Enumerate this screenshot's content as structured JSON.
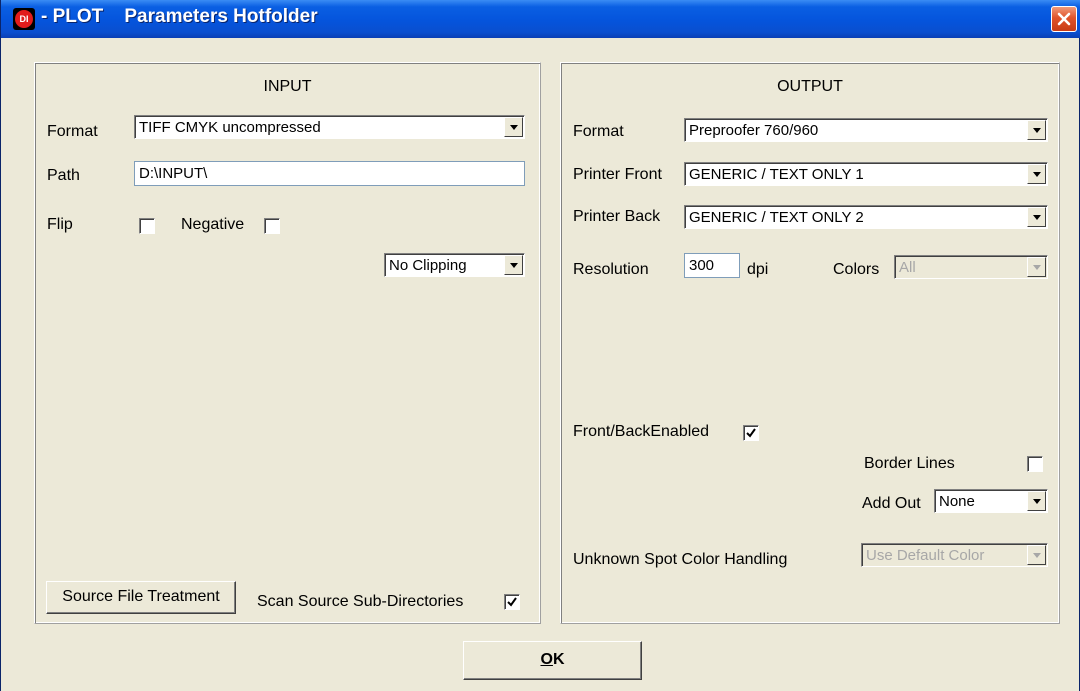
{
  "window": {
    "title": "- PLOT    Parameters Hotfolder",
    "icon_text": "DI"
  },
  "input": {
    "section_title": "INPUT",
    "format_label": "Format",
    "format_value": "TIFF CMYK uncompressed",
    "path_label": "Path",
    "path_value": "D:\\INPUT\\",
    "flip_label": "Flip",
    "flip_checked": false,
    "negative_label": "Negative",
    "negative_checked": false,
    "clipping_value": "No Clipping",
    "source_button_label": "Source File Treatment",
    "scan_subdirs_label": "Scan Source Sub-Directories",
    "scan_subdirs_checked": true
  },
  "output": {
    "section_title": "OUTPUT",
    "format_label": "Format",
    "format_value": "Preproofer 760/960",
    "printer_front_label": "Printer Front",
    "printer_front_value": "GENERIC / TEXT ONLY 1",
    "printer_back_label": "Printer Back",
    "printer_back_value": "GENERIC / TEXT ONLY 2",
    "resolution_label": "Resolution",
    "resolution_value": "300",
    "resolution_unit": "dpi",
    "colors_label": "Colors",
    "colors_value": "All",
    "front_back_label": "Front/BackEnabled",
    "front_back_checked": true,
    "border_lines_label": "Border Lines",
    "border_lines_checked": false,
    "add_out_label": "Add Out",
    "add_out_value": "None",
    "spot_color_label": "Unknown Spot Color Handling",
    "spot_color_value": "Use Default Color"
  },
  "footer": {
    "ok_label_underlined": "O",
    "ok_label_rest": "K"
  },
  "colors": {
    "titlebar": "#0554dc",
    "face": "#ece9d8",
    "close": "#e0542b"
  }
}
